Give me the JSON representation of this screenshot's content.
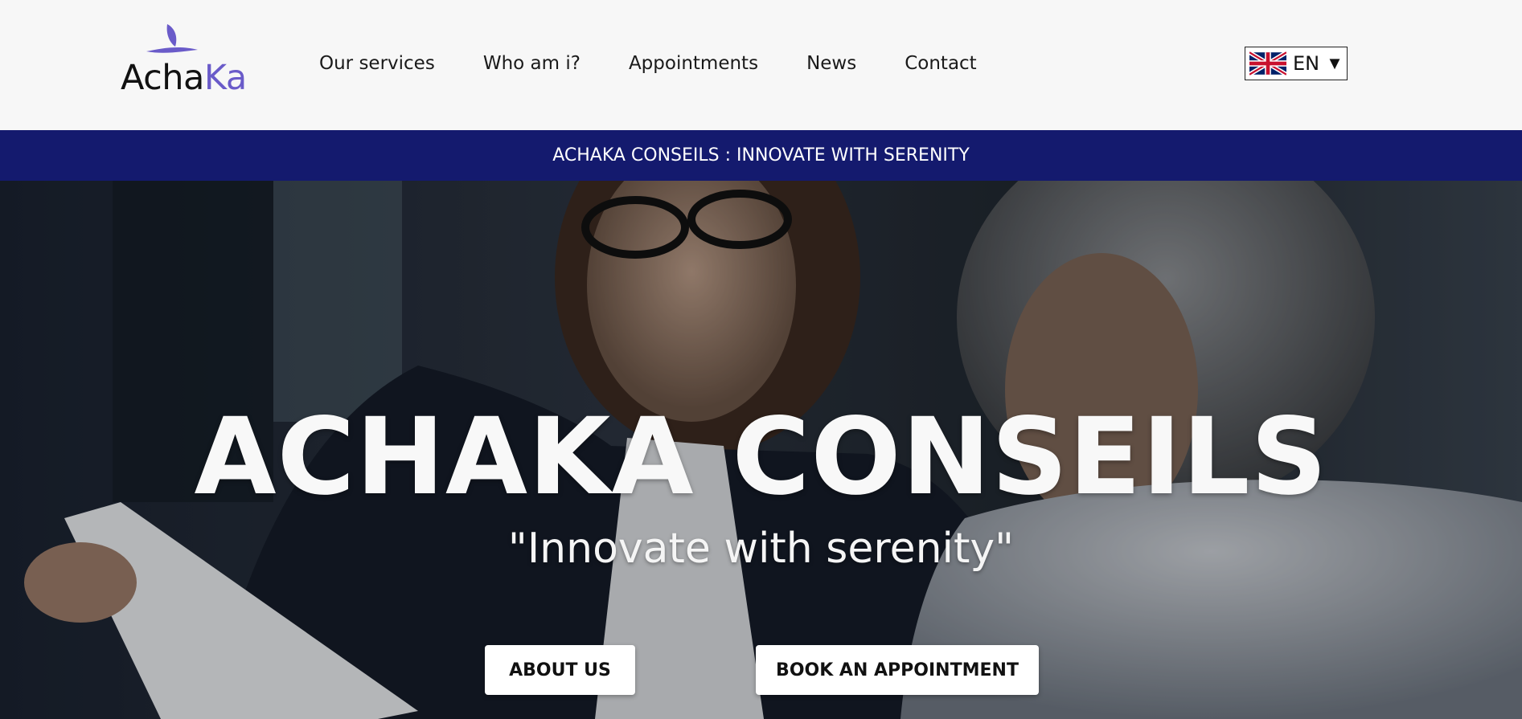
{
  "logo": {
    "text_main": "Acha",
    "text_accent": "Ka",
    "accent_color": "#6a5bc9"
  },
  "nav": {
    "items": [
      {
        "label": "Our services"
      },
      {
        "label": "Who am i?"
      },
      {
        "label": "Appointments"
      },
      {
        "label": "News"
      },
      {
        "label": "Contact"
      }
    ]
  },
  "language": {
    "selected": "EN",
    "flag_icon": "uk-flag-icon",
    "arrow": "▼"
  },
  "banner": {
    "text": "ACHAKA CONSEILS : INNOVATE WITH SERENITY",
    "color": "#141a6e"
  },
  "hero": {
    "title": "ACHAKA CONSEILS",
    "subtitle": "\"Innovate with serenity\"",
    "buttons": {
      "about": "ABOUT US",
      "book": "BOOK AN APPOINTMENT"
    }
  }
}
